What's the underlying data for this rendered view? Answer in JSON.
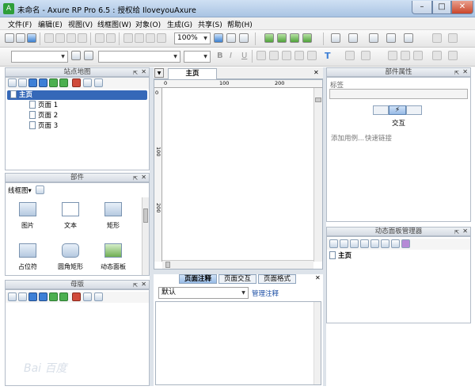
{
  "window": {
    "title": "未命名 - Axure RP Pro 6.5 : 授权给 IloveyouAxure",
    "minimize": "–",
    "maximize": "□",
    "close": "✕"
  },
  "menu": [
    "文件(F)",
    "编辑(E)",
    "视图(V)",
    "线框图(W)",
    "对象(O)",
    "生成(G)",
    "共享(S)",
    "帮助(H)"
  ],
  "toolbar": {
    "zoom": "100%",
    "font_bold": "B",
    "font_italic": "I",
    "font_underline": "U",
    "text_tool": "T"
  },
  "sitemap": {
    "title": "站点地图",
    "root": "主页",
    "pages": [
      "页面 1",
      "页面 2",
      "页面 3"
    ]
  },
  "widgets": {
    "title": "部件",
    "library": "线框图",
    "items": [
      "图片",
      "文本",
      "矩形",
      "占位符",
      "圆角矩形",
      "动态面板"
    ]
  },
  "masters": {
    "title": "母版"
  },
  "canvas": {
    "tab": "主页",
    "ruler_h": [
      "0",
      "100",
      "200"
    ],
    "ruler_v": [
      "0",
      "100",
      "200"
    ]
  },
  "notes": {
    "tabs": [
      "页面注释",
      "页面交互",
      "页面格式"
    ],
    "select_value": "默认",
    "manage_link": "管理注释"
  },
  "properties": {
    "title": "部件属性",
    "label_caption": "标签",
    "section": "交互",
    "add_case": "添加用例...",
    "quick_link": "快速链接"
  },
  "dynamic_panel": {
    "title": "动态面板管理器",
    "root": "主页"
  },
  "watermark": "Bai  百度"
}
